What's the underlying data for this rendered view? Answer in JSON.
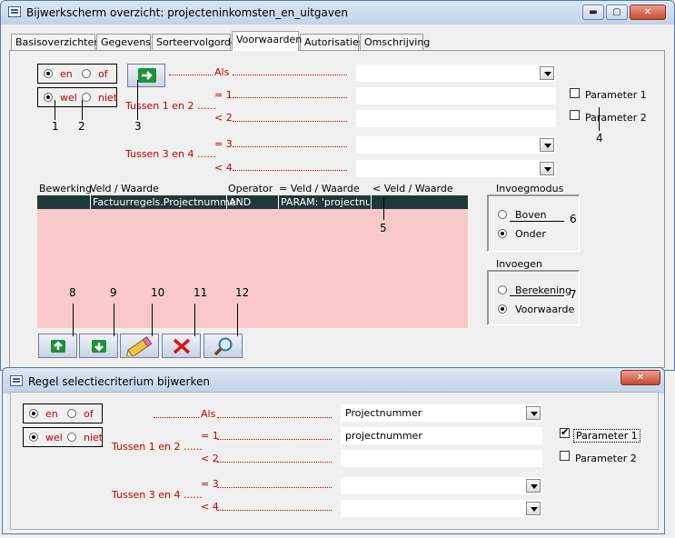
{
  "main_window": {
    "title": "Bijwerkscherm overzicht: projecteninkomsten_en_uitgaven",
    "controls": {
      "minimize": "▬",
      "maximize": "▢",
      "close": "✕"
    },
    "tabs": [
      "Basisoverzichten",
      "Gegevens",
      "Sorteervolgorde",
      "Voorwaarden",
      "Autorisaties",
      "Omschrijving"
    ],
    "active_tab": "Voorwaarden",
    "logic": {
      "en": "en",
      "of": "of",
      "wel": "wel",
      "niet": "niet"
    },
    "labels": {
      "als": "Als",
      "eq1": "= 1",
      "tussen12": "Tussen 1 en 2 ......",
      "lt2": "< 2",
      "eq3": "= 3",
      "tussen34": "Tussen 3 en 4 ......",
      "lt4": "< 4"
    },
    "params": {
      "p1": "Parameter 1",
      "p2": "Parameter 2"
    },
    "grid": {
      "headers": [
        "Bewerking",
        "Veld / Waarde",
        "Operator",
        "= Veld / Waarde",
        "< Veld / Waarde"
      ],
      "rows": [
        [
          "",
          "Factuurregels.Projectnummer",
          "AND",
          "PARAM: 'projectnum",
          ""
        ]
      ]
    },
    "invoegmodus": {
      "title": "Invoegmodus",
      "boven": "Boven",
      "onder": "Onder"
    },
    "invoegen": {
      "title": "Invoegen",
      "berekening": "Berekening",
      "voorwaarde": "Voorwaarde"
    },
    "callouts": [
      "1",
      "2",
      "3",
      "4",
      "5",
      "6",
      "7",
      "8",
      "9",
      "10",
      "11",
      "12"
    ]
  },
  "dialog": {
    "title": "Regel selectiecriterium bijwerken",
    "close": "✕",
    "logic": {
      "en": "en",
      "of": "of",
      "wel": "wel",
      "niet": "niet"
    },
    "labels": {
      "als": "Als",
      "eq1": "= 1",
      "tussen12": "Tussen 1 en 2 ......",
      "lt2": "< 2",
      "eq3": "= 3",
      "tussen34": "Tussen 3 en 4 ......",
      "lt4": "< 4"
    },
    "values": {
      "als": "Projectnummer",
      "eq1": "projectnummer",
      "lt2": "",
      "eq3": "",
      "lt4": ""
    },
    "params": {
      "p1": "Parameter 1",
      "p2": "Parameter 2"
    }
  },
  "colors": {
    "label_red": "#c00000",
    "grid_bg": "#f9c9c9",
    "grid_row": "#1f3838",
    "titlebar": "#bfd3e8"
  }
}
